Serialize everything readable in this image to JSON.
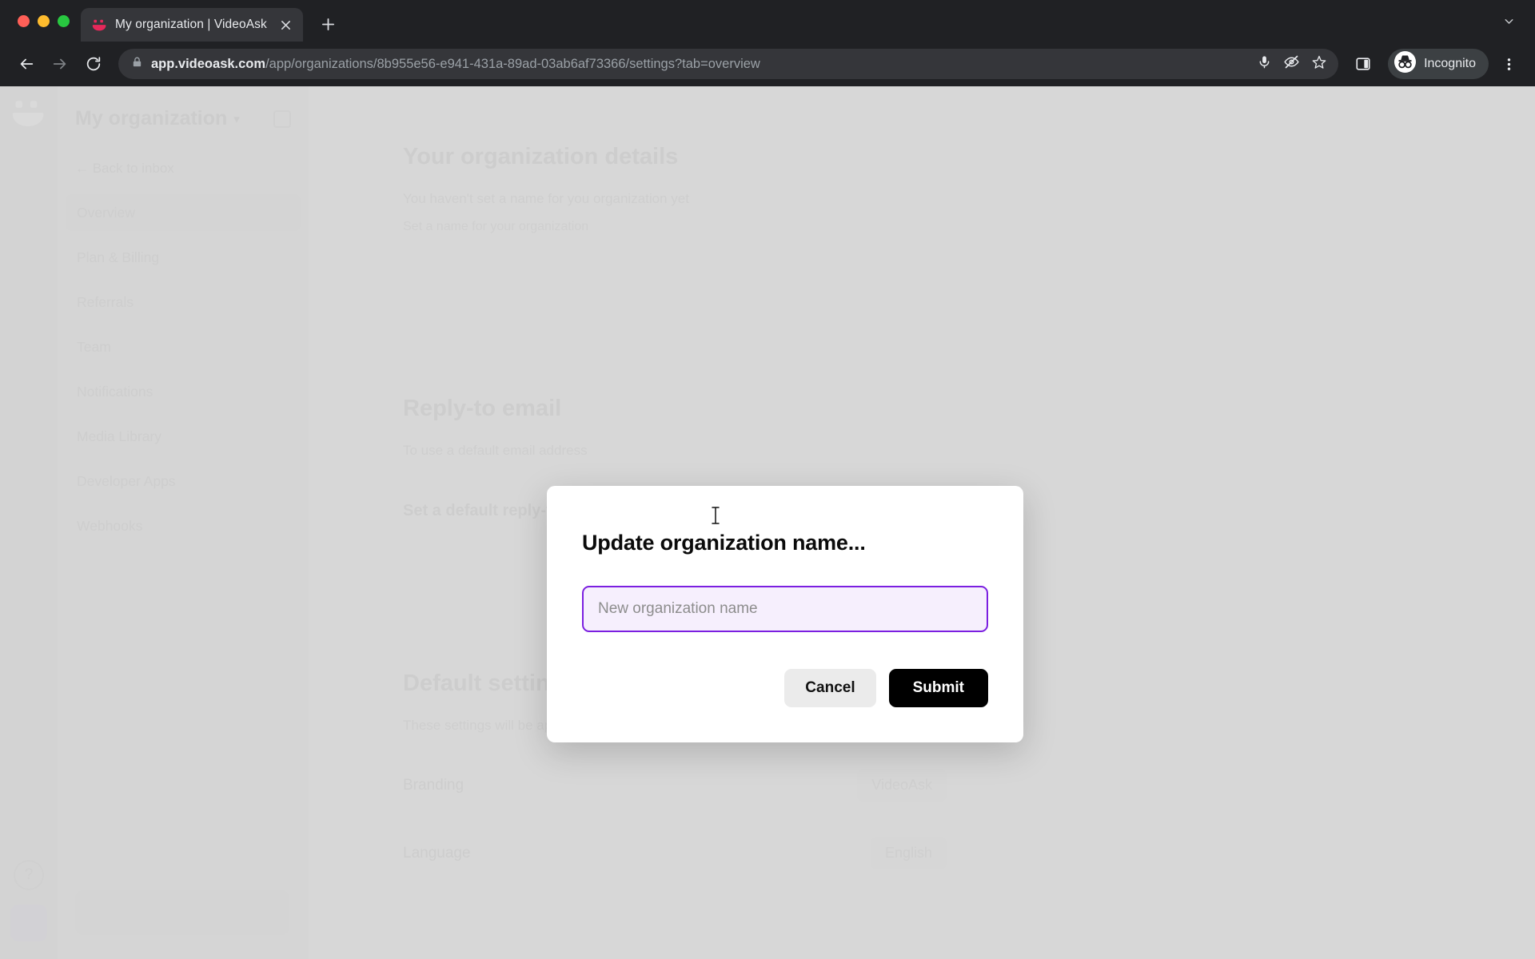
{
  "browser": {
    "tab": {
      "title": "My organization | VideoAsk",
      "favicon_icon": "videoask-smiley-icon",
      "close_icon": "close-icon"
    },
    "new_tab_icon": "plus-icon",
    "tab_list_icon": "chevron-down-icon",
    "nav": {
      "back_icon": "back-arrow-icon",
      "forward_icon": "forward-arrow-icon",
      "reload_icon": "reload-icon"
    },
    "omnibox": {
      "lock_icon": "lock-icon",
      "host": "app.videoask.com",
      "path": "/app/organizations/8b955e56-e941-431a-89ad-03ab6af73366/settings?tab=overview",
      "full_url": "app.videoask.com/app/organizations/8b955e56-e941-431a-89ad-03ab6af73366/settings?tab=overview",
      "mic_icon": "microphone-icon",
      "tracking_icon": "eye-slash-icon",
      "bookmark_icon": "star-icon"
    },
    "side_panel_icon": "side-panel-icon",
    "incognito": {
      "label": "Incognito",
      "icon": "incognito-hat-icon"
    },
    "menu_icon": "three-dot-menu-icon"
  },
  "app": {
    "rail": {
      "logo_icon": "videoask-logo-icon",
      "help_icon": "help-question-icon",
      "avatar_icon": "user-avatar"
    },
    "sidebar": {
      "org_title": "My organization",
      "org_caret_icon": "chevron-down-icon",
      "org_settings_icon": "gear-icon",
      "back_link": "← Back to inbox",
      "items": [
        {
          "label": "Overview",
          "active": true
        },
        {
          "label": "Plan & Billing",
          "active": false
        },
        {
          "label": "Referrals",
          "active": false
        },
        {
          "label": "Team",
          "active": false
        },
        {
          "label": "Notifications",
          "active": false
        },
        {
          "label": "Media Library",
          "active": false
        },
        {
          "label": "Developer Apps",
          "active": false
        },
        {
          "label": "Webhooks",
          "active": false
        }
      ]
    },
    "content": {
      "org_details_heading": "Your organization details",
      "org_details_text": "You haven't set a name for you organization yet",
      "org_details_link": "Set a name for your organization",
      "reply_to_heading": "Reply-to email",
      "reply_to_sub": "Set a default reply-to email",
      "reply_to_text": "To use a default email address",
      "defaults_heading": "Default settings for all new videoasks",
      "defaults_text": "These settings will be applied to all new videoasks created in this organization",
      "rows": [
        {
          "label": "Branding",
          "value": "VideoAsk"
        },
        {
          "label": "Language",
          "value": "English"
        }
      ]
    }
  },
  "modal": {
    "title": "Update organization name...",
    "input_placeholder": "New organization name",
    "input_value": "",
    "cancel_label": "Cancel",
    "submit_label": "Submit"
  },
  "colors": {
    "accent_purple": "#7b1fe0",
    "input_fill": "#f6effd",
    "submit_bg": "#000000",
    "cancel_bg": "#ebebeb",
    "chrome_bg": "#202124",
    "favicon_pink": "#e6285a"
  }
}
